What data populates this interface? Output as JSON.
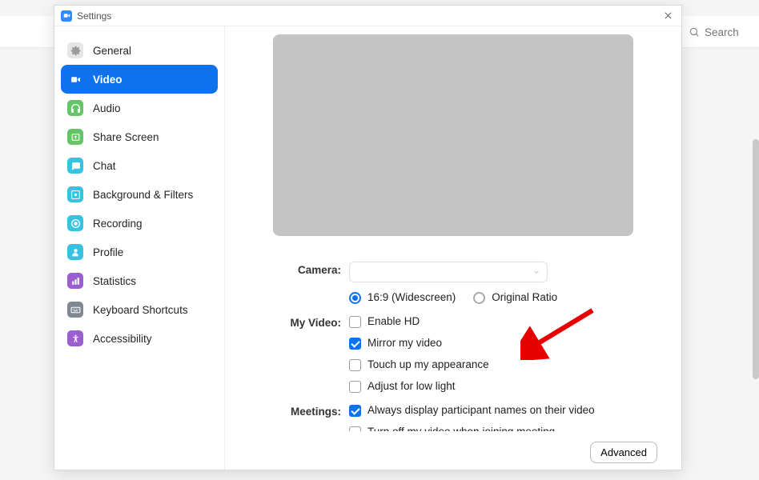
{
  "window": {
    "title": "Settings"
  },
  "bg": {
    "search_placeholder": "Search"
  },
  "sidebar": {
    "items": [
      {
        "label": "General",
        "icon": "gear-icon",
        "bg": "#e6e6e6",
        "fg": "#9b9b9b"
      },
      {
        "label": "Video",
        "icon": "video-icon",
        "bg": "#0e72ed",
        "fg": "#ffffff",
        "active": true
      },
      {
        "label": "Audio",
        "icon": "headphones-icon",
        "bg": "#65c468",
        "fg": "#ffffff"
      },
      {
        "label": "Share Screen",
        "icon": "share-icon",
        "bg": "#65c468",
        "fg": "#ffffff"
      },
      {
        "label": "Chat",
        "icon": "chat-icon",
        "bg": "#37c2e0",
        "fg": "#ffffff"
      },
      {
        "label": "Background & Filters",
        "icon": "filters-icon",
        "bg": "#37c2e0",
        "fg": "#ffffff"
      },
      {
        "label": "Recording",
        "icon": "record-icon",
        "bg": "#37c2e0",
        "fg": "#ffffff"
      },
      {
        "label": "Profile",
        "icon": "profile-icon",
        "bg": "#37c2e0",
        "fg": "#ffffff"
      },
      {
        "label": "Statistics",
        "icon": "stats-icon",
        "bg": "#9b5ecf",
        "fg": "#ffffff"
      },
      {
        "label": "Keyboard Shortcuts",
        "icon": "keyboard-icon",
        "bg": "#808893",
        "fg": "#ffffff"
      },
      {
        "label": "Accessibility",
        "icon": "accessibility-icon",
        "bg": "#9b5ecf",
        "fg": "#ffffff"
      }
    ]
  },
  "form": {
    "camera_label": "Camera:",
    "camera_selected": "",
    "aspect": {
      "wide": "16:9 (Widescreen)",
      "original": "Original Ratio",
      "selected": "wide"
    },
    "myvideo_label": "My Video:",
    "myvideo": {
      "enable_hd": {
        "label": "Enable HD",
        "checked": false
      },
      "mirror": {
        "label": "Mirror my video",
        "checked": true
      },
      "touchup": {
        "label": "Touch up my appearance",
        "checked": false
      },
      "lowlight": {
        "label": "Adjust for low light",
        "checked": false
      }
    },
    "meetings_label": "Meetings:",
    "meetings": {
      "display_names": {
        "label": "Always display participant names on their video",
        "checked": true
      },
      "video_off_join": {
        "label": "Turn off my video when joining meeting",
        "checked": false
      },
      "third": {
        "label": "",
        "checked": true
      }
    },
    "advanced_label": "Advanced"
  }
}
